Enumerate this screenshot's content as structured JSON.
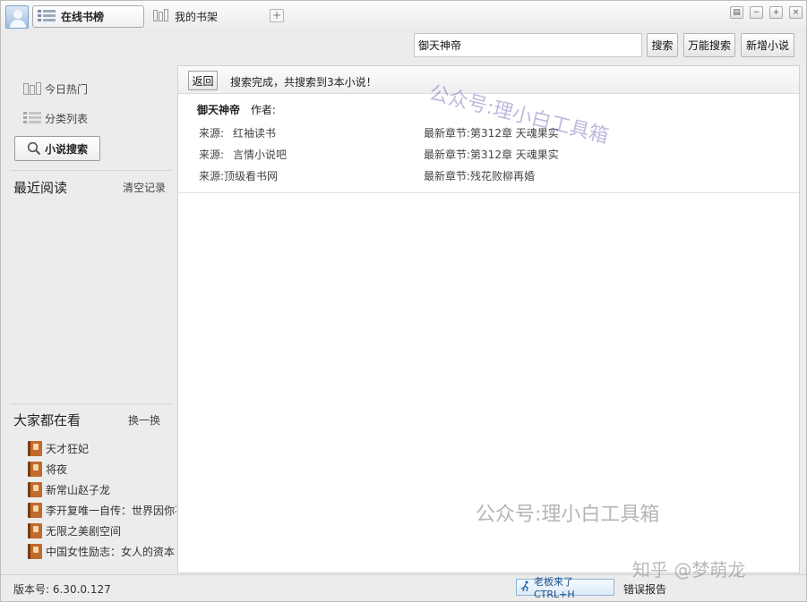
{
  "titlebar": {
    "tabs": [
      {
        "label": "在线书榜",
        "active": true
      },
      {
        "label": "我的书架",
        "active": false
      }
    ],
    "add_tab_label": "+",
    "window_buttons": [
      "▤",
      "−",
      "+",
      "×"
    ]
  },
  "toolbar": {
    "search_value": "御天神帝",
    "search_button": "搜索",
    "all_search_button": "万能搜索",
    "add_novel_button": "新增小说"
  },
  "sidebar": {
    "items": [
      {
        "label": "今日热门"
      },
      {
        "label": "分类列表"
      }
    ],
    "novel_search_label": "小说搜索",
    "recent": {
      "title": "最近阅读",
      "clear_label": "清空记录"
    },
    "popular": {
      "title": "大家都在看",
      "refresh_label": "换一换",
      "books": [
        "天才狂妃",
        "将夜",
        "新常山赵子龙",
        "李开复唯一自传：世界因你不同",
        "无限之美剧空间",
        "中国女性励志：女人的资本"
      ]
    }
  },
  "main": {
    "back_label": "返回",
    "status_text": "搜索完成，共搜索到3本小说！",
    "result": {
      "title": "御天神帝",
      "author_label": "作者:",
      "sources": [
        {
          "source_label": "来源:",
          "source": "红袖读书",
          "chapter_label": "最新章节:",
          "chapter": "第312章  天魂果实"
        },
        {
          "source_label": "来源:",
          "source": "言情小说吧",
          "chapter_label": "最新章节:",
          "chapter": "第312章  天魂果实"
        },
        {
          "source_label": "来源:",
          "source": "顶级看书网",
          "chapter_label": "最新章节:",
          "chapter": "残花败柳再婚"
        }
      ]
    },
    "watermark_top": "公众号:理小白工具箱",
    "watermark_bottom": "公众号:理小白工具箱"
  },
  "statusbar": {
    "version": "版本号: 6.30.0.127",
    "boss_label": "老板来了CTRL+H",
    "report_label": "错误报告",
    "zhihu_watermark": "知乎 @梦萌龙"
  }
}
